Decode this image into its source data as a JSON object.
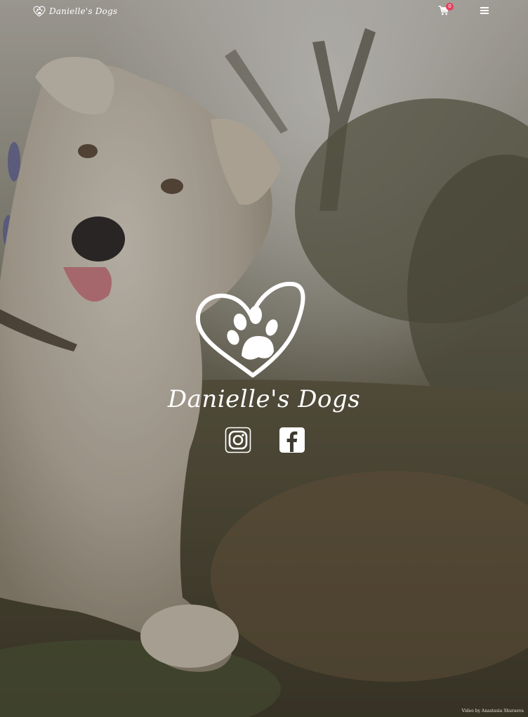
{
  "header": {
    "brand_name": "Danielle's Dogs",
    "brand_logo_icon": "heart-paw-icon",
    "cart_icon": "cart-icon",
    "cart_count": "0",
    "menu_icon": "hamburger-menu-icon"
  },
  "hero": {
    "logo_icon": "heart-paw-icon",
    "title": "Danielle's Dogs",
    "social": [
      {
        "icon": "instagram-icon"
      },
      {
        "icon": "facebook-icon"
      }
    ],
    "video_credit": "Video by Anastasia Shuraeva"
  },
  "colors": {
    "badge": "#e3425f",
    "text": "#ffffff"
  }
}
